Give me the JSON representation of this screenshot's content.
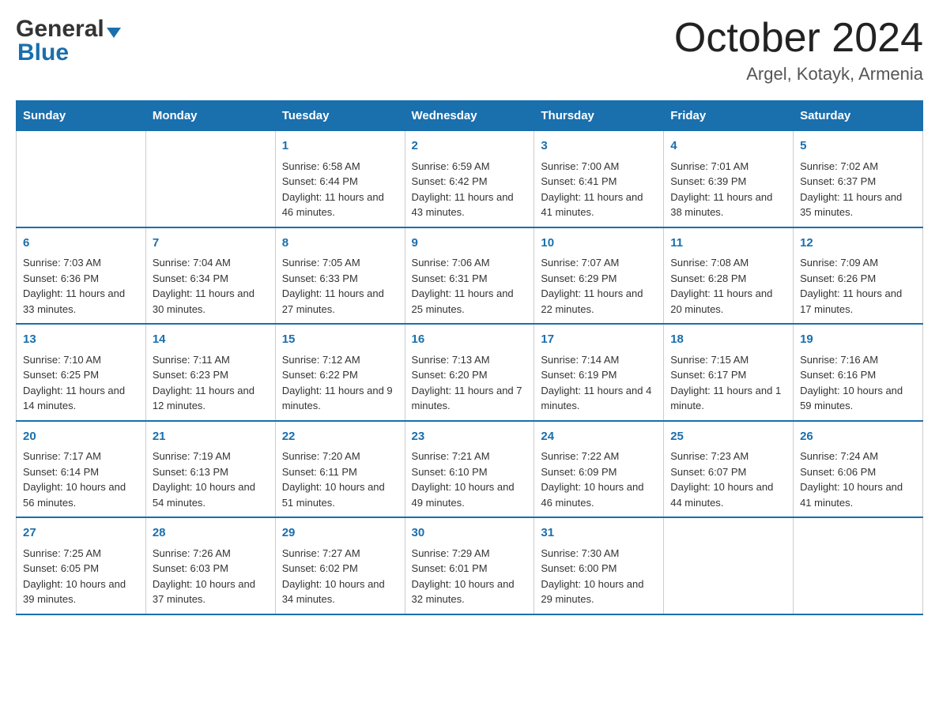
{
  "logo": {
    "general": "General",
    "blue": "Blue",
    "triangle": "▼"
  },
  "title": "October 2024",
  "location": "Argel, Kotayk, Armenia",
  "headers": [
    "Sunday",
    "Monday",
    "Tuesday",
    "Wednesday",
    "Thursday",
    "Friday",
    "Saturday"
  ],
  "weeks": [
    [
      {
        "day": "",
        "info": ""
      },
      {
        "day": "",
        "info": ""
      },
      {
        "day": "1",
        "info": "Sunrise: 6:58 AM\nSunset: 6:44 PM\nDaylight: 11 hours and 46 minutes."
      },
      {
        "day": "2",
        "info": "Sunrise: 6:59 AM\nSunset: 6:42 PM\nDaylight: 11 hours and 43 minutes."
      },
      {
        "day": "3",
        "info": "Sunrise: 7:00 AM\nSunset: 6:41 PM\nDaylight: 11 hours and 41 minutes."
      },
      {
        "day": "4",
        "info": "Sunrise: 7:01 AM\nSunset: 6:39 PM\nDaylight: 11 hours and 38 minutes."
      },
      {
        "day": "5",
        "info": "Sunrise: 7:02 AM\nSunset: 6:37 PM\nDaylight: 11 hours and 35 minutes."
      }
    ],
    [
      {
        "day": "6",
        "info": "Sunrise: 7:03 AM\nSunset: 6:36 PM\nDaylight: 11 hours and 33 minutes."
      },
      {
        "day": "7",
        "info": "Sunrise: 7:04 AM\nSunset: 6:34 PM\nDaylight: 11 hours and 30 minutes."
      },
      {
        "day": "8",
        "info": "Sunrise: 7:05 AM\nSunset: 6:33 PM\nDaylight: 11 hours and 27 minutes."
      },
      {
        "day": "9",
        "info": "Sunrise: 7:06 AM\nSunset: 6:31 PM\nDaylight: 11 hours and 25 minutes."
      },
      {
        "day": "10",
        "info": "Sunrise: 7:07 AM\nSunset: 6:29 PM\nDaylight: 11 hours and 22 minutes."
      },
      {
        "day": "11",
        "info": "Sunrise: 7:08 AM\nSunset: 6:28 PM\nDaylight: 11 hours and 20 minutes."
      },
      {
        "day": "12",
        "info": "Sunrise: 7:09 AM\nSunset: 6:26 PM\nDaylight: 11 hours and 17 minutes."
      }
    ],
    [
      {
        "day": "13",
        "info": "Sunrise: 7:10 AM\nSunset: 6:25 PM\nDaylight: 11 hours and 14 minutes."
      },
      {
        "day": "14",
        "info": "Sunrise: 7:11 AM\nSunset: 6:23 PM\nDaylight: 11 hours and 12 minutes."
      },
      {
        "day": "15",
        "info": "Sunrise: 7:12 AM\nSunset: 6:22 PM\nDaylight: 11 hours and 9 minutes."
      },
      {
        "day": "16",
        "info": "Sunrise: 7:13 AM\nSunset: 6:20 PM\nDaylight: 11 hours and 7 minutes."
      },
      {
        "day": "17",
        "info": "Sunrise: 7:14 AM\nSunset: 6:19 PM\nDaylight: 11 hours and 4 minutes."
      },
      {
        "day": "18",
        "info": "Sunrise: 7:15 AM\nSunset: 6:17 PM\nDaylight: 11 hours and 1 minute."
      },
      {
        "day": "19",
        "info": "Sunrise: 7:16 AM\nSunset: 6:16 PM\nDaylight: 10 hours and 59 minutes."
      }
    ],
    [
      {
        "day": "20",
        "info": "Sunrise: 7:17 AM\nSunset: 6:14 PM\nDaylight: 10 hours and 56 minutes."
      },
      {
        "day": "21",
        "info": "Sunrise: 7:19 AM\nSunset: 6:13 PM\nDaylight: 10 hours and 54 minutes."
      },
      {
        "day": "22",
        "info": "Sunrise: 7:20 AM\nSunset: 6:11 PM\nDaylight: 10 hours and 51 minutes."
      },
      {
        "day": "23",
        "info": "Sunrise: 7:21 AM\nSunset: 6:10 PM\nDaylight: 10 hours and 49 minutes."
      },
      {
        "day": "24",
        "info": "Sunrise: 7:22 AM\nSunset: 6:09 PM\nDaylight: 10 hours and 46 minutes."
      },
      {
        "day": "25",
        "info": "Sunrise: 7:23 AM\nSunset: 6:07 PM\nDaylight: 10 hours and 44 minutes."
      },
      {
        "day": "26",
        "info": "Sunrise: 7:24 AM\nSunset: 6:06 PM\nDaylight: 10 hours and 41 minutes."
      }
    ],
    [
      {
        "day": "27",
        "info": "Sunrise: 7:25 AM\nSunset: 6:05 PM\nDaylight: 10 hours and 39 minutes."
      },
      {
        "day": "28",
        "info": "Sunrise: 7:26 AM\nSunset: 6:03 PM\nDaylight: 10 hours and 37 minutes."
      },
      {
        "day": "29",
        "info": "Sunrise: 7:27 AM\nSunset: 6:02 PM\nDaylight: 10 hours and 34 minutes."
      },
      {
        "day": "30",
        "info": "Sunrise: 7:29 AM\nSunset: 6:01 PM\nDaylight: 10 hours and 32 minutes."
      },
      {
        "day": "31",
        "info": "Sunrise: 7:30 AM\nSunset: 6:00 PM\nDaylight: 10 hours and 29 minutes."
      },
      {
        "day": "",
        "info": ""
      },
      {
        "day": "",
        "info": ""
      }
    ]
  ]
}
